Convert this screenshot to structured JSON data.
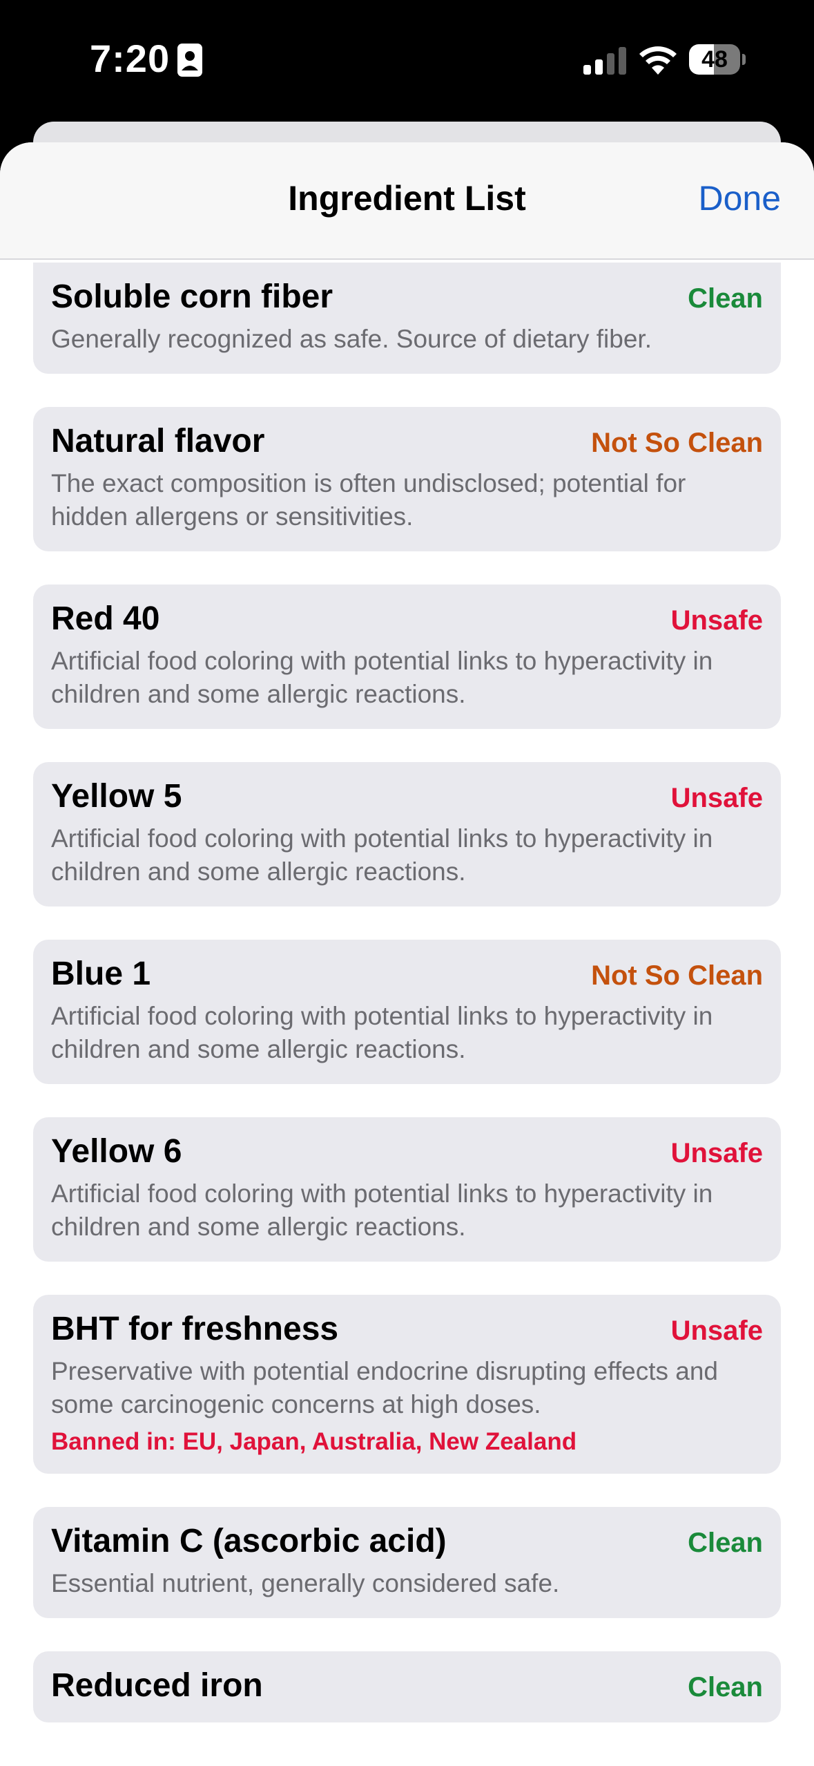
{
  "status_bar": {
    "time": "7:20",
    "battery": "48",
    "battery_level": 0.48
  },
  "navbar": {
    "title": "Ingredient List",
    "done_label": "Done"
  },
  "colors": {
    "clean": "#1a8a3a",
    "not_so_clean": "#c4510d",
    "unsafe": "#e0123a",
    "link": "#1a5fc9"
  },
  "ingredients": [
    {
      "name": "Soluble corn fiber",
      "rating": "Clean",
      "description": "Generally recognized as safe. Source of dietary fiber."
    },
    {
      "name": "Natural flavor",
      "rating": "Not So Clean",
      "description": "The exact composition is often undisclosed; potential for hidden allergens or sensitivities."
    },
    {
      "name": "Red 40",
      "rating": "Unsafe",
      "description": "Artificial food coloring with potential links to hyperactivity in children and some allergic reactions."
    },
    {
      "name": "Yellow 5",
      "rating": "Unsafe",
      "description": "Artificial food coloring with potential links to hyperactivity in children and some allergic reactions."
    },
    {
      "name": "Blue 1",
      "rating": "Not So Clean",
      "description": "Artificial food coloring with potential links to hyperactivity in children and some allergic reactions."
    },
    {
      "name": "Yellow 6",
      "rating": "Unsafe",
      "description": "Artificial food coloring with potential links to hyperactivity in children and some allergic reactions."
    },
    {
      "name": "BHT for freshness",
      "rating": "Unsafe",
      "description": "Preservative with potential endocrine disrupting effects and some carcinogenic concerns at high doses.",
      "banned": "Banned in: EU, Japan, Australia, New Zealand"
    },
    {
      "name": "Vitamin C (ascorbic acid)",
      "rating": "Clean",
      "description": "Essential nutrient, generally considered safe."
    },
    {
      "name": "Reduced iron",
      "rating": "Clean",
      "description": ""
    }
  ]
}
